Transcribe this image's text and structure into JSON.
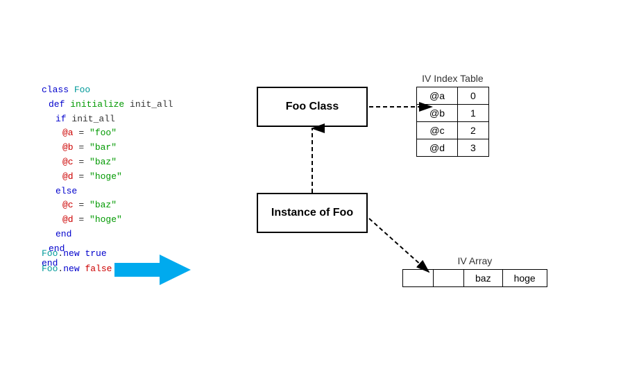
{
  "code": {
    "line1": "class ",
    "line1_class": "Foo",
    "line2_indent": "  ",
    "line2_def": "def ",
    "line2_method": "initialize ",
    "line2_param": "init_all",
    "line3_indent": "    ",
    "line3_if": "if ",
    "line3_param": "init_all",
    "line4_indent": "      ",
    "line4_var": "@a",
    "line4_val": "\"foo\"",
    "line5_indent": "      ",
    "line5_var": "@b",
    "line5_val": "\"bar\"",
    "line6_indent": "      ",
    "line6_var": "@c",
    "line6_val": "\"baz\"",
    "line7_indent": "      ",
    "line7_var": "@d",
    "line7_val": "\"hoge\"",
    "line8_indent": "    ",
    "line8_else": "else",
    "line9_indent": "      ",
    "line9_var": "@c",
    "line9_val": "\"baz\"",
    "line10_indent": "      ",
    "line10_var": "@d",
    "line10_val": "\"hoge\"",
    "line11_indent": "    ",
    "line11_end": "end",
    "line12_indent": "  ",
    "line12_end": "end",
    "line13_end": "end"
  },
  "bottom_code": {
    "line1_class": "Foo",
    "line1_dot": ".",
    "line1_method": "new ",
    "line1_true": "true",
    "line2_class": "Foo",
    "line2_dot": ".",
    "line2_method": "new ",
    "line2_false": "false"
  },
  "diagram": {
    "foo_class_label": "Foo Class",
    "instance_label": "Instance of Foo"
  },
  "iv_index_table": {
    "title": "IV Index Table",
    "rows": [
      {
        "var": "@a",
        "index": "0"
      },
      {
        "var": "@b",
        "index": "1"
      },
      {
        "var": "@c",
        "index": "2"
      },
      {
        "var": "@d",
        "index": "3"
      }
    ]
  },
  "iv_array": {
    "title": "IV Array",
    "cells": [
      "",
      "",
      "baz",
      "hoge"
    ]
  }
}
